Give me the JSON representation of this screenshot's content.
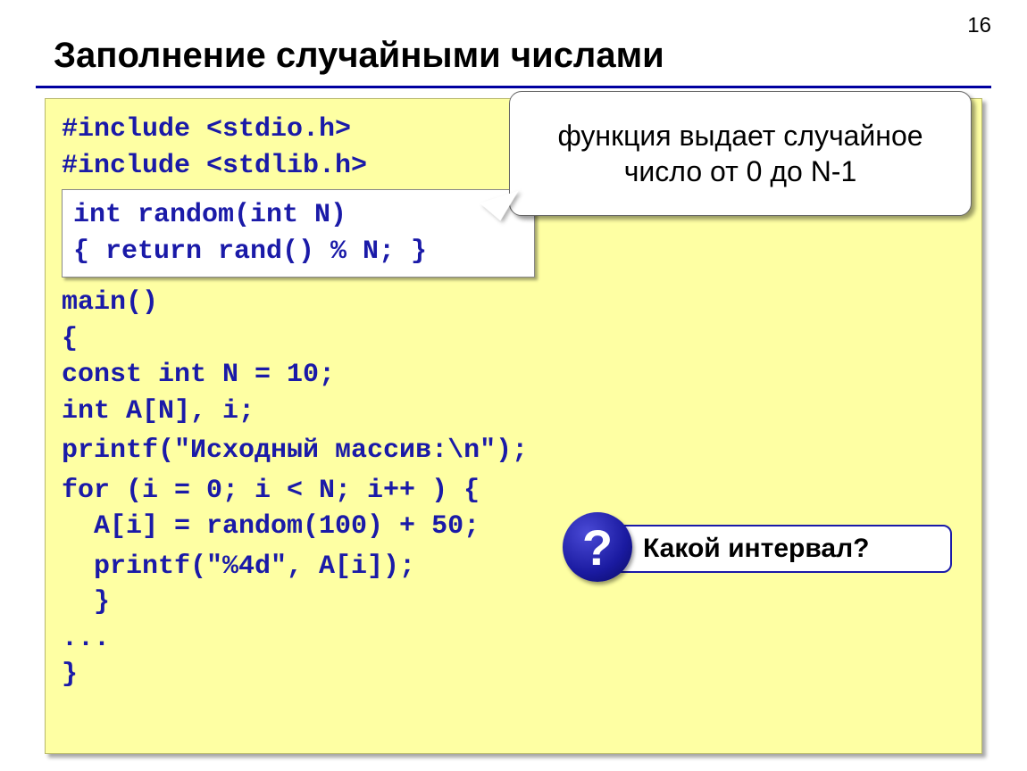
{
  "page_number": "16",
  "title": "Заполнение случайными числами",
  "code": {
    "include1": "#include <stdio.h>",
    "include2": "#include <stdlib.h>",
    "random_fn_line1": "int random(int N)",
    "random_fn_line2": "{ return rand() % N; }",
    "main_line": "main()",
    "brace_open": "{",
    "const_line": "const int N = 10;",
    "decl_line": "int A[N], i;",
    "printf_header": "printf(\"Исходный массив:\\n\");",
    "for_line": "for (i = 0; i < N; i++ ) {",
    "assign_line": "  A[i] = random(100) + 50;",
    "printf_item": "  printf(\"%4d\", A[i]);",
    "inner_close": "  }",
    "ellipsis": "...",
    "brace_close": "}"
  },
  "callout_text": "функция выдает случайное число от 0 до N-1",
  "question_label": "Какой интервал?",
  "question_mark": "?"
}
